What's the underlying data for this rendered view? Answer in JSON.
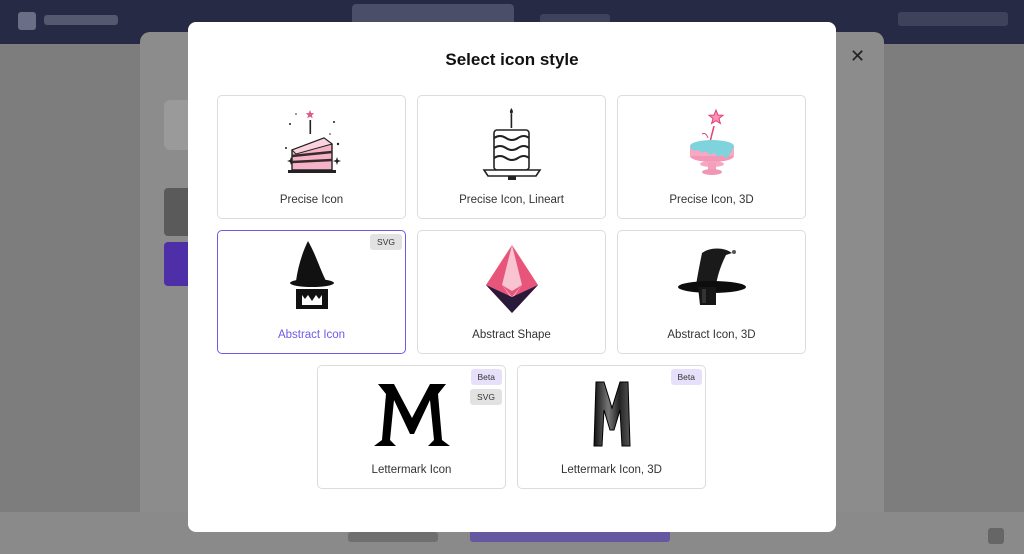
{
  "modal": {
    "title": "Select icon style"
  },
  "cards": [
    {
      "label": "Precise Icon",
      "icon": "cake-icon"
    },
    {
      "label": "Precise Icon, Lineart",
      "icon": "cake-lineart-icon"
    },
    {
      "label": "Precise Icon, 3D",
      "icon": "cake-3d-icon"
    },
    {
      "label": "Abstract Icon",
      "icon": "witch-hat-icon",
      "selected": true,
      "badges": [
        "SVG"
      ]
    },
    {
      "label": "Abstract Shape",
      "icon": "diamond-shape-icon"
    },
    {
      "label": "Abstract Icon, 3D",
      "icon": "witch-hat-3d-icon"
    },
    {
      "label": "Lettermark Icon",
      "icon": "letter-m-icon",
      "badges": [
        "Beta",
        "SVG"
      ]
    },
    {
      "label": "Lettermark Icon, 3D",
      "icon": "letter-m-3d-icon",
      "badges": [
        "Beta"
      ]
    }
  ],
  "colors": {
    "accent": "#6c5ce7",
    "beta_badge": "#e7e0fb",
    "svg_badge": "#e2e2e2",
    "topbar": "#262a45"
  }
}
